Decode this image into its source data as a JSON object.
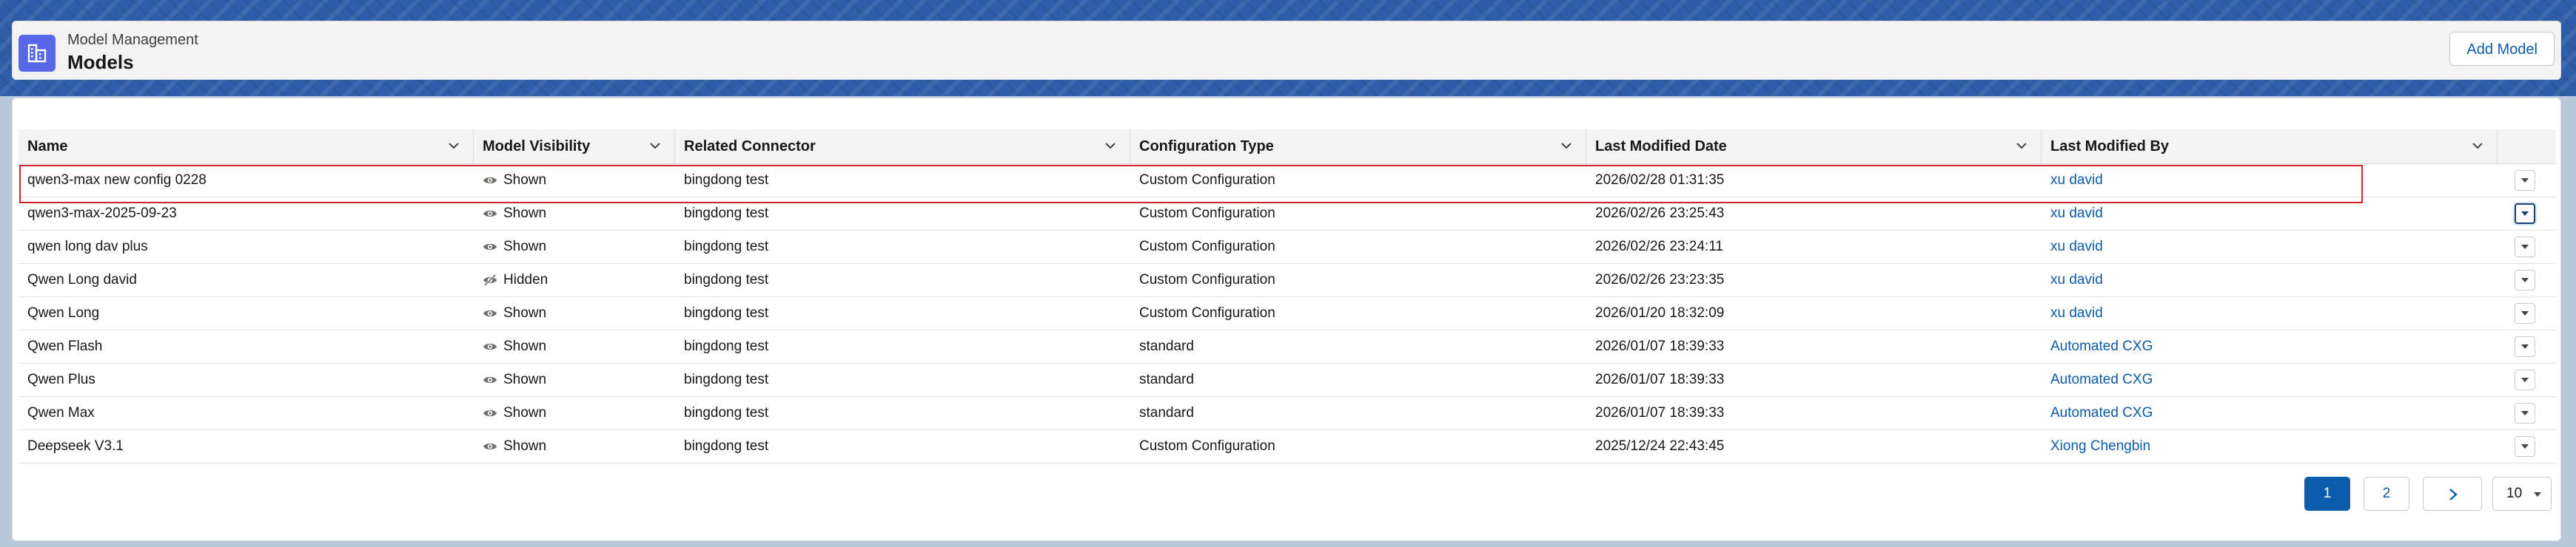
{
  "header": {
    "eyebrow": "Model Management",
    "title": "Models",
    "add_label": "Add Model"
  },
  "table": {
    "columns": [
      {
        "label": "Name"
      },
      {
        "label": "Model Visibility"
      },
      {
        "label": "Related Connector"
      },
      {
        "label": "Configuration Type"
      },
      {
        "label": "Last Modified Date"
      },
      {
        "label": "Last Modified By"
      }
    ],
    "rows": [
      {
        "name": "qwen3-max new config 0228",
        "visibility": "Shown",
        "connector": "bingdong test",
        "config": "Custom Configuration",
        "date": "2026/02/28 01:31:35",
        "by": "xu david"
      },
      {
        "name": "qwen3-max-2025-09-23",
        "visibility": "Shown",
        "connector": "bingdong test",
        "config": "Custom Configuration",
        "date": "2026/02/26 23:25:43",
        "by": "xu david"
      },
      {
        "name": "qwen long dav plus",
        "visibility": "Shown",
        "connector": "bingdong test",
        "config": "Custom Configuration",
        "date": "2026/02/26 23:24:11",
        "by": "xu david"
      },
      {
        "name": "Qwen Long david",
        "visibility": "Hidden",
        "connector": "bingdong test",
        "config": "Custom Configuration",
        "date": "2026/02/26 23:23:35",
        "by": "xu david"
      },
      {
        "name": "Qwen Long",
        "visibility": "Shown",
        "connector": "bingdong test",
        "config": "Custom Configuration",
        "date": "2026/01/20 18:32:09",
        "by": "xu david"
      },
      {
        "name": "Qwen Flash",
        "visibility": "Shown",
        "connector": "bingdong test",
        "config": "standard",
        "date": "2026/01/07 18:39:33",
        "by": "Automated CXG"
      },
      {
        "name": "Qwen Plus",
        "visibility": "Shown",
        "connector": "bingdong test",
        "config": "standard",
        "date": "2026/01/07 18:39:33",
        "by": "Automated CXG"
      },
      {
        "name": "Qwen Max",
        "visibility": "Shown",
        "connector": "bingdong test",
        "config": "standard",
        "date": "2026/01/07 18:39:33",
        "by": "Automated CXG"
      },
      {
        "name": "Deepseek V3.1",
        "visibility": "Shown",
        "connector": "bingdong test",
        "config": "Custom Configuration",
        "date": "2025/12/24 22:43:45",
        "by": "Xiong Chengbin"
      }
    ]
  },
  "pagination": {
    "pages": [
      "1",
      "2"
    ],
    "current_page": "1",
    "page_size": "10"
  },
  "colors": {
    "brand": "#0b5cab",
    "app_icon": "#5867e8",
    "highlight": "#d6202a"
  },
  "icons": [
    "model-management-icon",
    "eye-icon",
    "eye-slash-icon",
    "chevron-down-icon",
    "chevron-right-icon"
  ]
}
